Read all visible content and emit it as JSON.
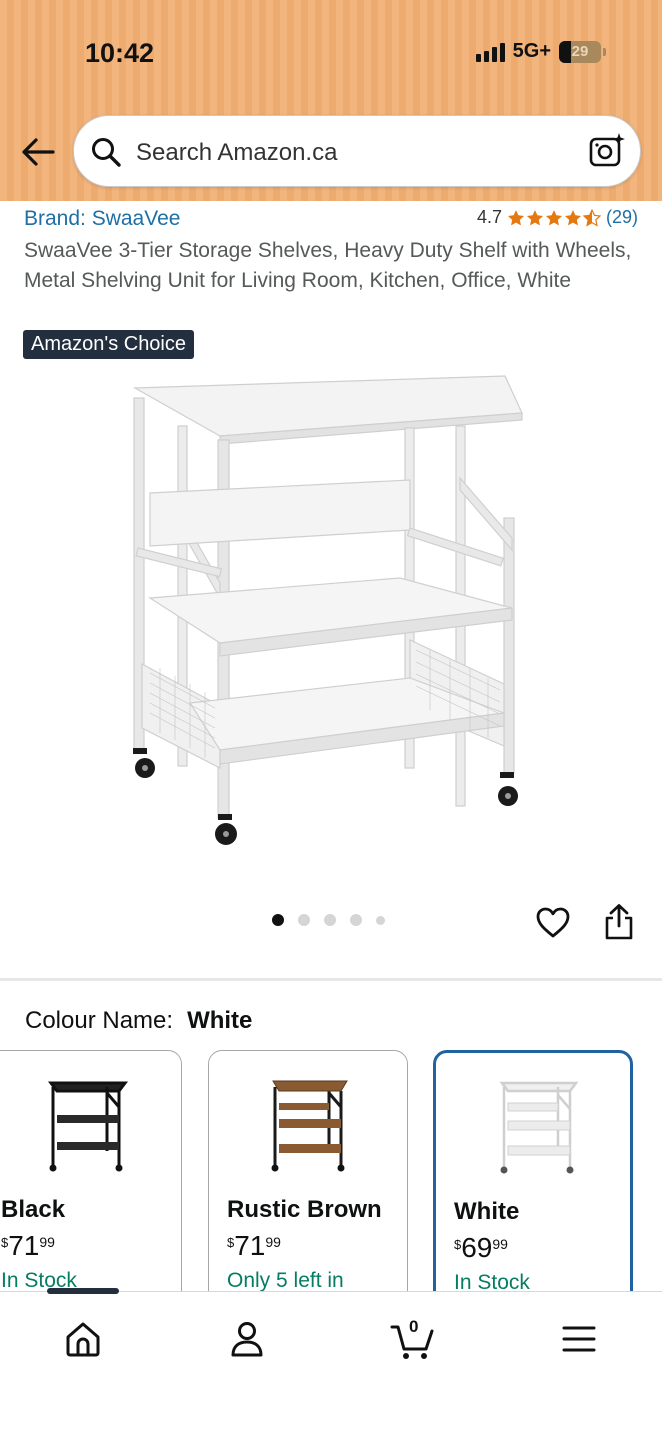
{
  "status_bar": {
    "time": "10:42",
    "network": "5G+",
    "battery": "29"
  },
  "header": {
    "search_placeholder": "Search Amazon.ca"
  },
  "icons": {
    "back": "arrow-left-icon",
    "search": "search-icon",
    "camera": "camera-lens-icon",
    "heart": "heart-icon",
    "share": "share-icon",
    "home": "home-icon",
    "account": "person-icon",
    "cart": "cart-icon",
    "menu": "hamburger-menu-icon"
  },
  "product": {
    "brand": "Brand: SwaaVee",
    "rating_value": "4.7",
    "rating": 4.5,
    "rating_count": "(29)",
    "title": "SwaaVee 3-Tier Storage Shelves, Heavy Duty Shelf with Wheels, Metal Shelving Unit for Living Room, Kitchen, Office, White",
    "badge": "Amazon's Choice",
    "image_count": 5,
    "active_image": 1
  },
  "colour": {
    "label": "Colour Name:",
    "selected": "White",
    "options": [
      {
        "name": "Black",
        "currency": "$",
        "whole": "71",
        "fraction": "99",
        "stock": "In Stock",
        "frame": "#222222",
        "shelf": "#2a2a2a"
      },
      {
        "name": "Rustic Brown",
        "currency": "$",
        "whole": "71",
        "fraction": "99",
        "stock": "Only 5 left in",
        "frame": "#222222",
        "shelf": "#8a5a32"
      },
      {
        "name": "White",
        "currency": "$",
        "whole": "69",
        "fraction": "99",
        "stock": "In Stock",
        "frame": "#d9d9d9",
        "shelf": "#f0f0f0"
      }
    ]
  },
  "bottom_nav": {
    "cart_count": "0"
  },
  "colors": {
    "header_bg": "#f2b57e",
    "link": "#1d6fa5",
    "badge_bg": "#232f3e",
    "star": "#e47911",
    "in_stock": "#067d62",
    "selected_border": "#2162a1"
  }
}
